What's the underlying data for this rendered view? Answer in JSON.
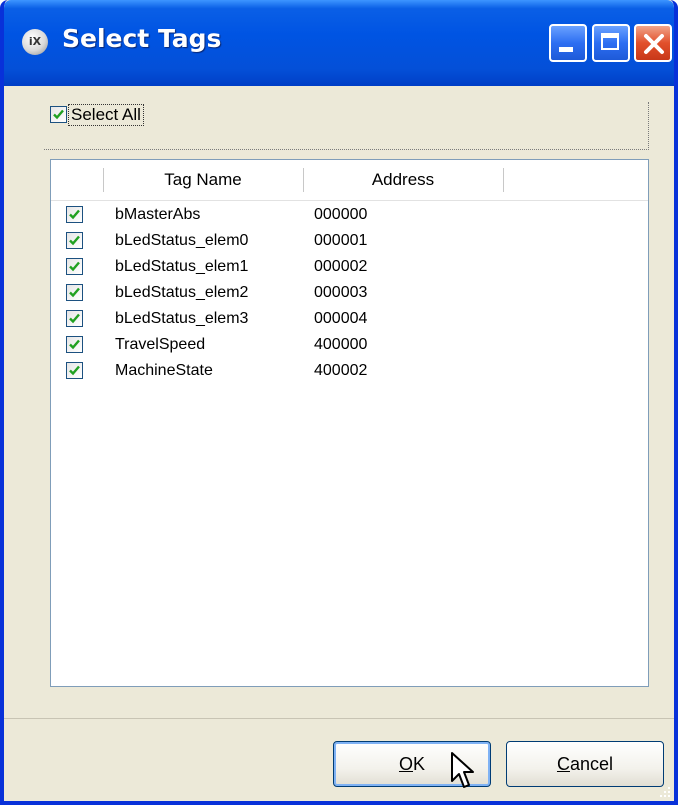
{
  "window": {
    "title": "Select Tags",
    "app_icon_label": "iX"
  },
  "select_all": {
    "label": "Select All",
    "checked": true
  },
  "table": {
    "columns": [
      "Tag Name",
      "Address"
    ],
    "rows": [
      {
        "name": "bMasterAbs",
        "address": "000000",
        "checked": true
      },
      {
        "name": "bLedStatus_elem0",
        "address": "000001",
        "checked": true
      },
      {
        "name": "bLedStatus_elem1",
        "address": "000002",
        "checked": true
      },
      {
        "name": "bLedStatus_elem2",
        "address": "000003",
        "checked": true
      },
      {
        "name": "bLedStatus_elem3",
        "address": "000004",
        "checked": true
      },
      {
        "name": "TravelSpeed",
        "address": "400000",
        "checked": true
      },
      {
        "name": "MachineState",
        "address": "400002",
        "checked": true
      }
    ]
  },
  "buttons": {
    "ok": {
      "label": "OK",
      "mnemonic": "O"
    },
    "cancel": {
      "label": "Cancel",
      "mnemonic": "C"
    }
  },
  "colors": {
    "titlebar": "#0054e3",
    "dialog_bg": "#ece9d8",
    "check_green": "#21a121",
    "close_button": "#e2502b"
  }
}
